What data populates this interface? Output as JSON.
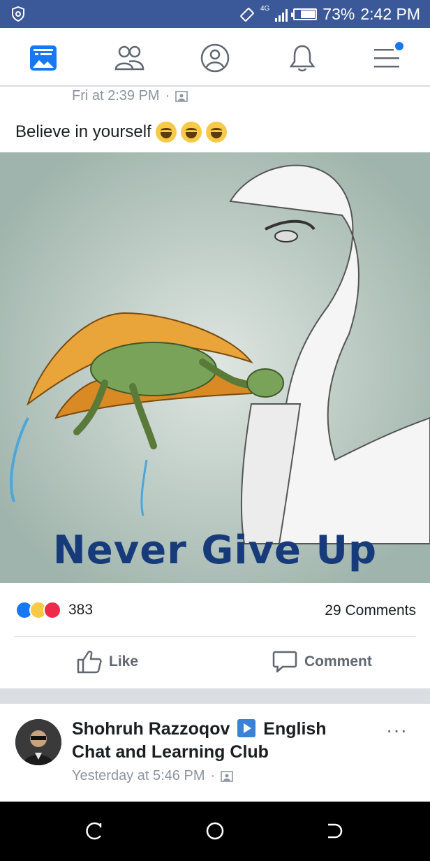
{
  "status_bar": {
    "network": "4G",
    "battery": "73%",
    "battery_level": 0.73,
    "time": "2:42 PM"
  },
  "nav": {
    "items": [
      {
        "name": "news-feed",
        "icon": "news-feed-icon",
        "active": true
      },
      {
        "name": "friends",
        "icon": "friends-icon",
        "active": false
      },
      {
        "name": "profile",
        "icon": "profile-icon",
        "active": false
      },
      {
        "name": "notifications",
        "icon": "bell-icon",
        "active": false
      },
      {
        "name": "menu",
        "icon": "menu-icon",
        "active": false,
        "badge": true
      }
    ]
  },
  "post": {
    "timestamp": "Fri at 2:39 PM",
    "caption": "Believe in yourself",
    "image_text": "Never Give Up",
    "reaction_count": "383",
    "comments": "29 Comments",
    "like_label": "Like",
    "comment_label": "Comment"
  },
  "next_post": {
    "author_part1": "Shohruh Razzoqov",
    "author_part2": "English Chat and Learning Club",
    "time": "Yesterday at 5:46 PM",
    "more": "···"
  },
  "colors": {
    "brand": "#3b5998",
    "accent": "#1877f2",
    "text": "#1c1e21",
    "muted": "#8d949e",
    "poster_text": "#173a7a"
  }
}
